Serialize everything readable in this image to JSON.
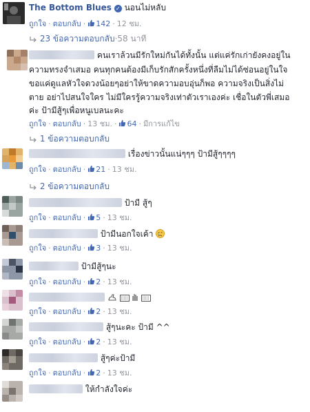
{
  "actions": {
    "like": "ถูกใจ",
    "reply": "ตอบกลับ",
    "sep": "·"
  },
  "icons": {
    "like": "thumbs-up-icon",
    "reply_arrow": "reply-arrow-icon",
    "verified": "verified-badge-icon"
  },
  "colors": {
    "link": "#365899",
    "accent": "#4267b2",
    "meta": "#90949c"
  },
  "main_comment": {
    "author": "The Bottom Blues",
    "text": "นอนไม่หลับ",
    "likes": "142",
    "time": "12 ชม.",
    "replies_label": "23 ข้อความตอบกลับ",
    "replies_time": "58 นาที"
  },
  "comments": [
    {
      "line1": "คนเราล้วนมีรักใหม่กันได้ทั้งนั้น แต่แค่รักเก่ายังคงอยู่ใน",
      "line2": "ความทรงจำเสมอ คนทุกคนต้องมีเก็บรักสักครั้งหนึ่งที่ลืมไม่ได้ซ่อนอยู่ในใจ",
      "line3": "ขอแค่ดูแลหัวใจดวงน้อยๆอย่าให้ขาดความอบอุ่นก็พอ ความจริงเป็นสิ่งไม่",
      "line4": "ตาย อย่าไปสนใจใคร ไม่มีใครรู้ความจริงเท่าตัวเราเองค่ะ เชื่อในตัวพี่เสมอ",
      "line5": "ค่ะ ป้ามีสู้ๆเพื่อหนูเบลนะคะ",
      "likes": "64",
      "time": "13 ชม.",
      "edited": "มีการแก้ไข",
      "replies_label": "1 ข้อความตอบกลับ"
    },
    {
      "text": "เรื่องข่าวนั้นแน่ๆๆๆ ป้ามีสู้ๆๆๆๆ",
      "likes": "21",
      "time": "13 ชม.",
      "replies_label": "2 ข้อความตอบกลับ"
    },
    {
      "text": "ป้ามี สู้ๆ",
      "likes": "5",
      "time": "13 ชม."
    },
    {
      "text": "ป้ามีนอกใจเค้า",
      "likes": "3",
      "time": "13 ชม."
    },
    {
      "text": "ป้ามีสู้ๆนะ",
      "likes": "2",
      "time": "13 ชม."
    },
    {
      "text": "",
      "likes": "2",
      "time": "13 ชม."
    },
    {
      "text": "สู้ๆนะคะ ป้ามี ^^",
      "likes": "2",
      "time": "13 ชม."
    },
    {
      "text": "สู้ๆค่ะป้ามี",
      "likes": "2",
      "time": "13 ชม."
    },
    {
      "text": "ให้กำลังใจค่ะ",
      "likes": "",
      "time": ""
    }
  ]
}
